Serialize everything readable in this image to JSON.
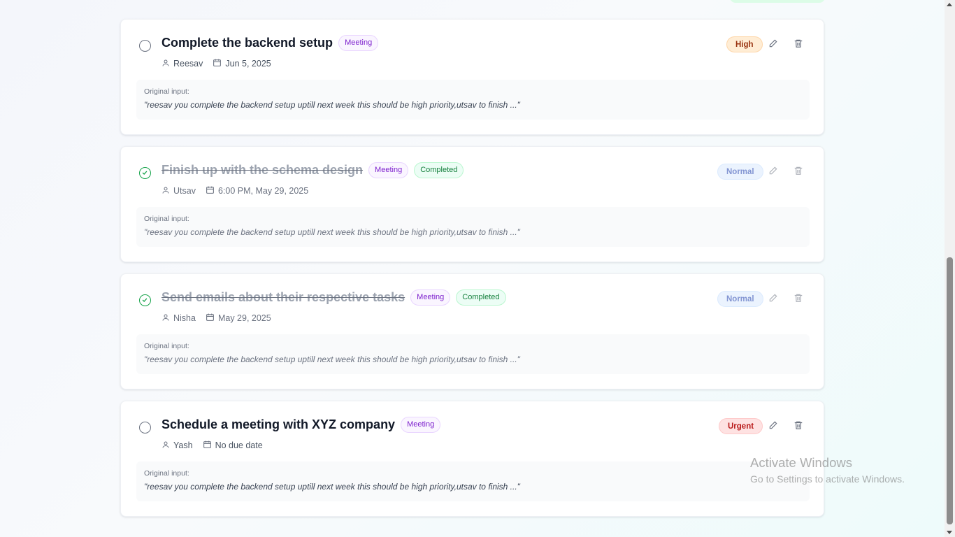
{
  "tasks": [
    {
      "title": "Complete the backend setup",
      "tags": [
        "Meeting"
      ],
      "assignee": "Reesav",
      "due": "Jun 5, 2025",
      "priority": "High",
      "completed": false,
      "original_label": "Original input:",
      "original_text": "\"reesav you complete the backend setup uptill next week this should be high priority,utsav to finish ...\""
    },
    {
      "title": "Finish up with the schema design",
      "tags": [
        "Meeting",
        "Completed"
      ],
      "assignee": "Utsav",
      "due": "6:00 PM, May 29, 2025",
      "priority": "Normal",
      "completed": true,
      "original_label": "Original input:",
      "original_text": "\"reesav you complete the backend setup uptill next week this should be high priority,utsav to finish ...\""
    },
    {
      "title": "Send emails about their respective tasks",
      "tags": [
        "Meeting",
        "Completed"
      ],
      "assignee": "Nisha",
      "due": "May 29, 2025",
      "priority": "Normal",
      "completed": true,
      "original_label": "Original input:",
      "original_text": "\"reesav you complete the backend setup uptill next week this should be high priority,utsav to finish ...\""
    },
    {
      "title": "Schedule a meeting with XYZ company",
      "tags": [
        "Meeting"
      ],
      "assignee": "Yash",
      "due": "No due date",
      "priority": "Urgent",
      "completed": false,
      "original_label": "Original input:",
      "original_text": "\"reesav you complete the backend setup uptill next week this should be high priority,utsav to finish ...\""
    }
  ],
  "colors": {
    "high": "#9a3412",
    "normal": "#1e40af",
    "urgent": "#b91c1c",
    "meeting": "#7e22ce",
    "completed": "#15803d"
  },
  "icons": {
    "assignee": "user-icon",
    "due": "calendar-icon",
    "edit": "pencil-icon",
    "delete": "trash-icon",
    "done": "check-circle-icon",
    "pending": "circle-icon"
  },
  "watermark": {
    "title": "Activate Windows",
    "subtitle": "Go to Settings to activate Windows."
  }
}
